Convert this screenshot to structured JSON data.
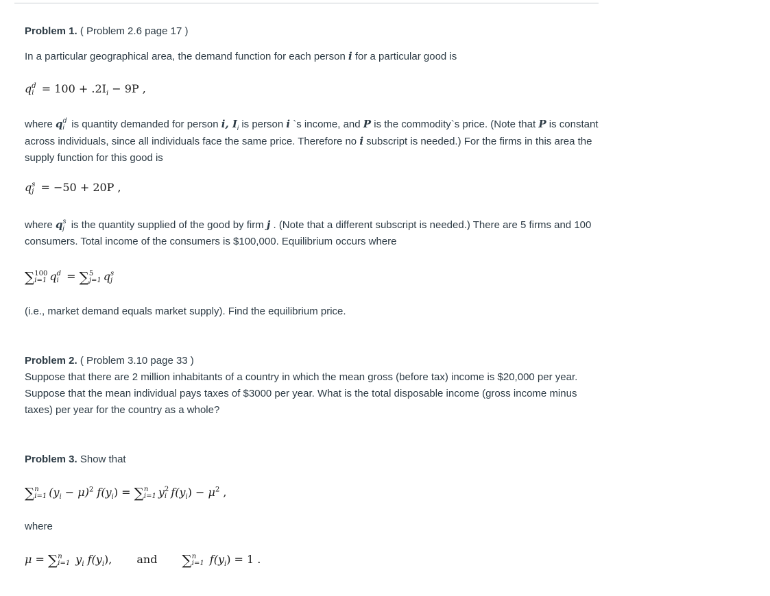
{
  "problem1": {
    "heading_bold": "Problem 1.",
    "heading_ref": " ( Problem 2.6 page 17 )",
    "intro_a": "In a particular geographical area, the demand function for each person ",
    "intro_var": "i",
    "intro_b": " for a particular good is",
    "demand_eq": {
      "lhs": "q",
      "sup": "d",
      "sub": "i",
      "rhs": " = 100 + .2I",
      "rhs_sub": "i",
      "rhs_tail": " − 9P ,"
    },
    "para2": {
      "t1": "where ",
      "t2": " is quantity demanded for person ",
      "v_i": "i",
      "comma": ", ",
      "v_I": "I",
      "t3": " is person ",
      "t4": " `s income, and ",
      "v_P": "P",
      "t5": " is the commodity`s price. (Note that ",
      "t6": " is constant across individuals, since all individuals face the same price. Therefore no ",
      "t7": " subscript is needed.) For the firms in this area the supply function for this good is"
    },
    "supply_eq": {
      "lhs": "q",
      "sup": "s",
      "sub": "j",
      "rhs": " = −50 + 20P ,"
    },
    "para3": {
      "t1": "where ",
      "t2": " is the quantity supplied of the good by firm ",
      "v_j": "j",
      "t3": " . (Note that a different subscript is needed.) There are 5 firms and 100 consumers. Total income of the consumers is $100,000. Equilibrium occurs where"
    },
    "equilibrium_eq": {
      "sig1_sup": "100",
      "sig1_sub": "i=1",
      "sig2_sup": "5",
      "sig2_sub": "j=1",
      "eq": " = "
    },
    "closing": "(i.e., market demand equals market supply). Find the equilibrium price."
  },
  "problem2": {
    "heading_bold": "Problem 2.",
    "heading_ref": " ( Problem 3.10 page 33 )",
    "body": "Suppose that there are 2 million inhabitants of a country in which the mean gross (before tax) income is $20,000 per year. Suppose that the mean individual pays taxes of $3000 per year. What is the total disposable income (gross income minus taxes) per year for the country as a whole?"
  },
  "problem3": {
    "heading_bold": "Problem 3.",
    "heading_rest": " Show that",
    "main_eq": {
      "sig_sup": "n",
      "sig_sub": "i=1",
      "left": "(y",
      "left_b": " − μ)",
      "sq": "2",
      "f": " f(y",
      "close": ")",
      "eq": " = ",
      "y2": "y",
      "minus": " − μ",
      "tail": " ,"
    },
    "where": "where",
    "mu_eq": {
      "lhs": "μ = ",
      "term": " y",
      "f": " f(y",
      "close": "),"
    },
    "and": "and",
    "sum_eq": {
      "f": " f(y",
      "close": ") = 1 ."
    }
  }
}
